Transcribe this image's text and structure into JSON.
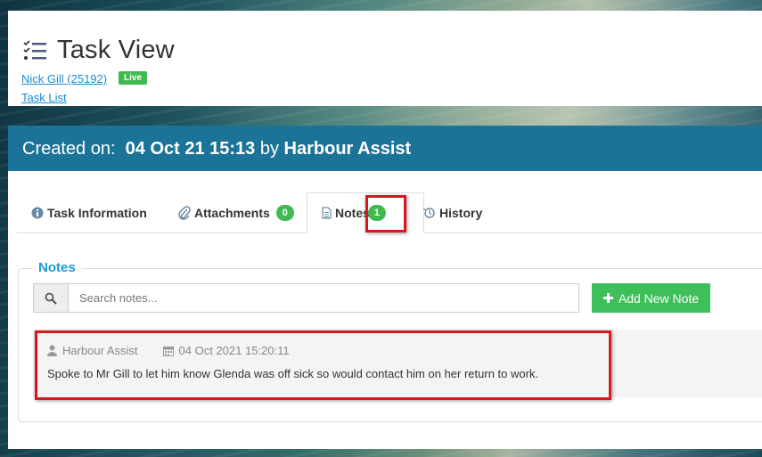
{
  "header": {
    "title": "Task View",
    "user_link": "Nick Gill (25192)",
    "status_badge": "Live",
    "task_list_link": "Task List"
  },
  "created": {
    "prefix": "Created on:",
    "date": "04 Oct 21 15:13",
    "by": "by",
    "author": "Harbour Assist"
  },
  "tabs": [
    {
      "label": "Task Information",
      "icon": "info-circle-icon"
    },
    {
      "label": "Attachments",
      "icon": "paperclip-icon",
      "count": "0"
    },
    {
      "label": "Notes",
      "icon": "document-icon",
      "count": "1"
    },
    {
      "label": "History",
      "icon": "history-icon"
    }
  ],
  "notes": {
    "legend": "Notes",
    "search_placeholder": "Search notes...",
    "add_button": "Add New Note",
    "items": [
      {
        "author": "Harbour Assist",
        "timestamp": "04 Oct 2021 15:20:11",
        "text": "Spoke to Mr Gill to let him know Glenda was off sick so would contact him on her return to work."
      }
    ]
  },
  "colors": {
    "primary_bar": "#1b7498",
    "success": "#3fb950",
    "link": "#1a8ccf",
    "highlight": "#d8181e"
  }
}
